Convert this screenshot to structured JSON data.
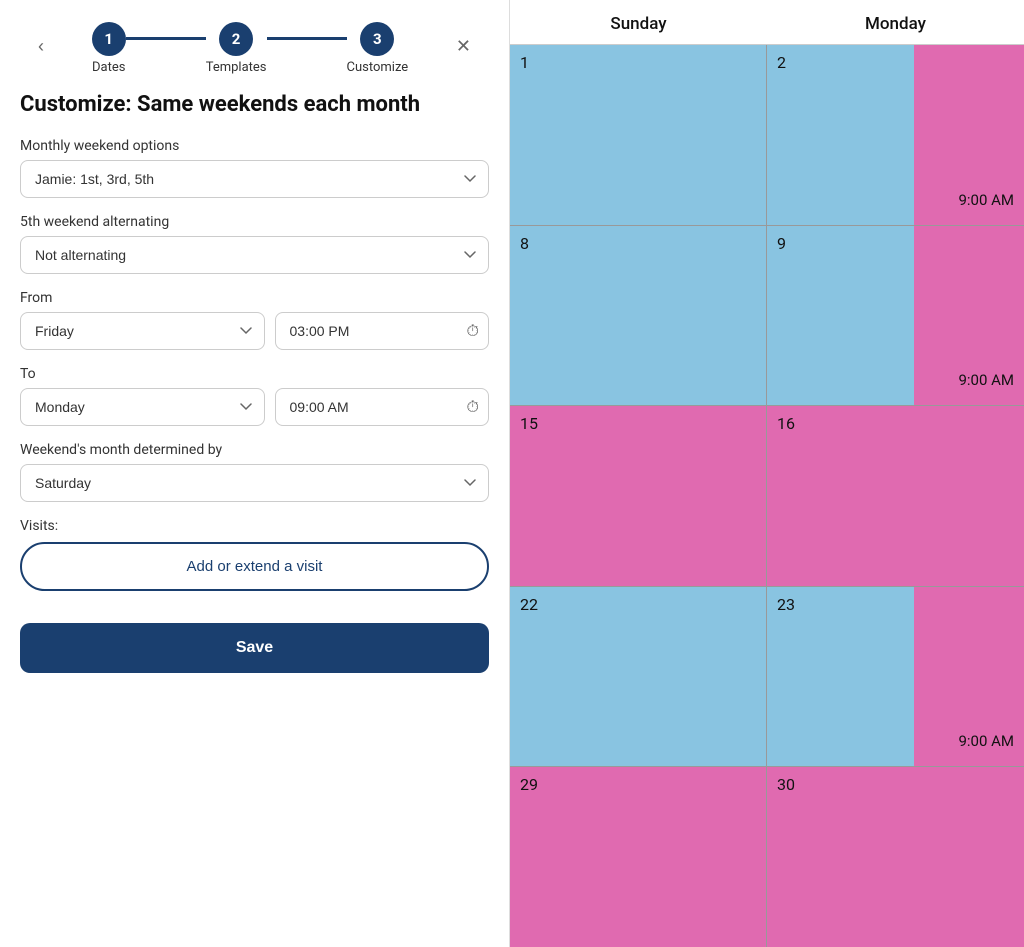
{
  "stepper": {
    "back_label": "‹",
    "close_label": "✕",
    "steps": [
      {
        "number": "1",
        "label": "Dates"
      },
      {
        "number": "2",
        "label": "Templates"
      },
      {
        "number": "3",
        "label": "Customize"
      }
    ]
  },
  "page_title": "Customize: Same weekends each month",
  "form": {
    "monthly_weekend_label": "Monthly weekend options",
    "monthly_weekend_value": "Jamie: 1st, 3rd, 5th",
    "fifth_weekend_label": "5th weekend alternating",
    "fifth_weekend_value": "Not alternating",
    "from_label": "From",
    "from_day": "Friday",
    "from_time": "03:00 PM",
    "to_label": "To",
    "to_day": "Monday",
    "to_time": "09:00 AM",
    "month_determined_label": "Weekend's month determined by",
    "month_determined_value": "Saturday",
    "visits_label": "Visits:",
    "add_visit_label": "Add or extend a visit",
    "save_label": "Save"
  },
  "calendar": {
    "header": [
      "Sunday",
      "Monday"
    ],
    "rows": [
      {
        "cells": [
          {
            "date": "1",
            "color": "blue",
            "time": ""
          },
          {
            "date": "2",
            "color": "split",
            "time": "9:00 AM"
          }
        ]
      },
      {
        "cells": [
          {
            "date": "8",
            "color": "blue",
            "time": ""
          },
          {
            "date": "9",
            "color": "split",
            "time": "9:00 AM"
          }
        ]
      },
      {
        "cells": [
          {
            "date": "15",
            "color": "pink",
            "time": ""
          },
          {
            "date": "16",
            "color": "pink",
            "time": ""
          }
        ]
      },
      {
        "cells": [
          {
            "date": "22",
            "color": "blue",
            "time": ""
          },
          {
            "date": "23",
            "color": "split",
            "time": "9:00 AM"
          }
        ]
      },
      {
        "cells": [
          {
            "date": "29",
            "color": "pink",
            "time": ""
          },
          {
            "date": "30",
            "color": "pink-split",
            "time": ""
          }
        ]
      }
    ]
  }
}
